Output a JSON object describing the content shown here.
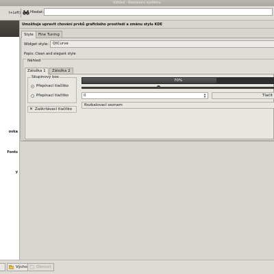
{
  "window": {
    "title": "Vzhled - Nastavení systému"
  },
  "toolbar": {
    "back_label": "t+Left)",
    "search_label": "Hledat:",
    "search_value": ""
  },
  "sidebar": {
    "items": [
      {
        "label": "ovka"
      },
      {
        "label": "Fonts"
      },
      {
        "label": "y"
      }
    ]
  },
  "main": {
    "description": "Umožňuje upravit chování prvků grafického prostředí a změnu stylu KDE",
    "tabs": [
      {
        "label": "Style",
        "active": true
      },
      {
        "label": "Fine Tuning",
        "active": false
      }
    ],
    "widget_style": {
      "label": "Widget style:",
      "value": "QtCurve"
    },
    "popis": "Popis: Clean and elegant style",
    "preview": {
      "title": "Náhled",
      "tabs": [
        {
          "label": "Záložka 1",
          "active": true
        },
        {
          "label": "Záložka 2",
          "active": false
        }
      ],
      "groupbox": {
        "title": "Skupinový box",
        "radios": [
          {
            "label": "Přepínací tlačítko",
            "checked": true
          },
          {
            "label": "Přepínací tlačítko",
            "checked": false
          }
        ]
      },
      "checkbox": {
        "label": "Zaškrtávací tlačítko",
        "checked": true
      },
      "progress": {
        "value": 0.7,
        "text": "70%"
      },
      "slider": {
        "value": 0.4
      },
      "spinbox": {
        "value": "0"
      },
      "button": {
        "label": "Tlačít"
      },
      "combo": {
        "label": "Rozbalovací seznam"
      }
    }
  },
  "bottom": {
    "defaults_label": "Výchozí",
    "reset_label": "Obnovit"
  }
}
